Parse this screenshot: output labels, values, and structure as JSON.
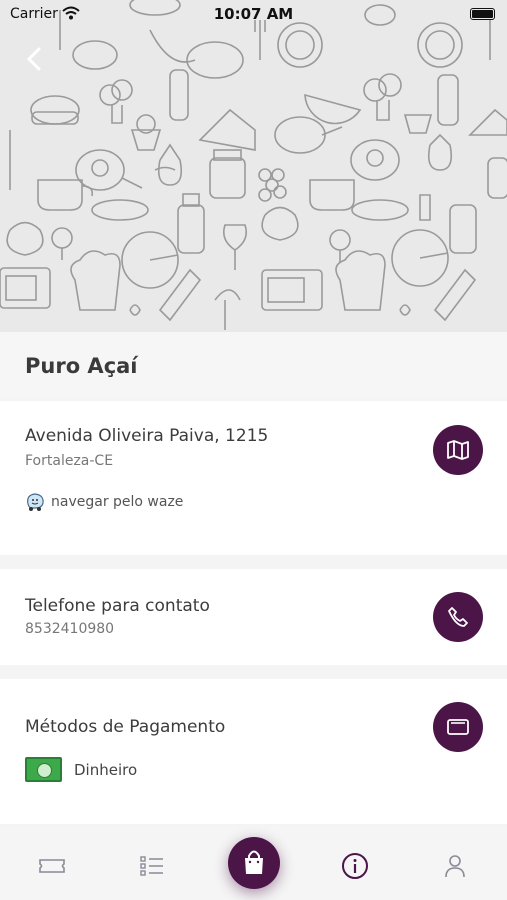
{
  "status_bar": {
    "carrier": "Carrier",
    "time": "10:07 AM"
  },
  "store": {
    "name": "Puro Açaí"
  },
  "address": {
    "street": "Avenida Oliveira Paiva, 1215",
    "city": "Fortaleza-CE",
    "waze_label": "navegar pelo waze"
  },
  "phone": {
    "label": "Telefone para contato",
    "number": "8532410980"
  },
  "payment": {
    "label": "Métodos de Pagamento",
    "method": "Dinheiro"
  },
  "colors": {
    "accent": "#4b1548",
    "money_green": "#3ca94a"
  },
  "tabbar": {
    "items": [
      {
        "icon": "ticket-icon"
      },
      {
        "icon": "list-icon"
      },
      {
        "icon": "shopping-bag-icon"
      },
      {
        "icon": "info-icon",
        "active": true
      },
      {
        "icon": "user-icon"
      }
    ]
  }
}
